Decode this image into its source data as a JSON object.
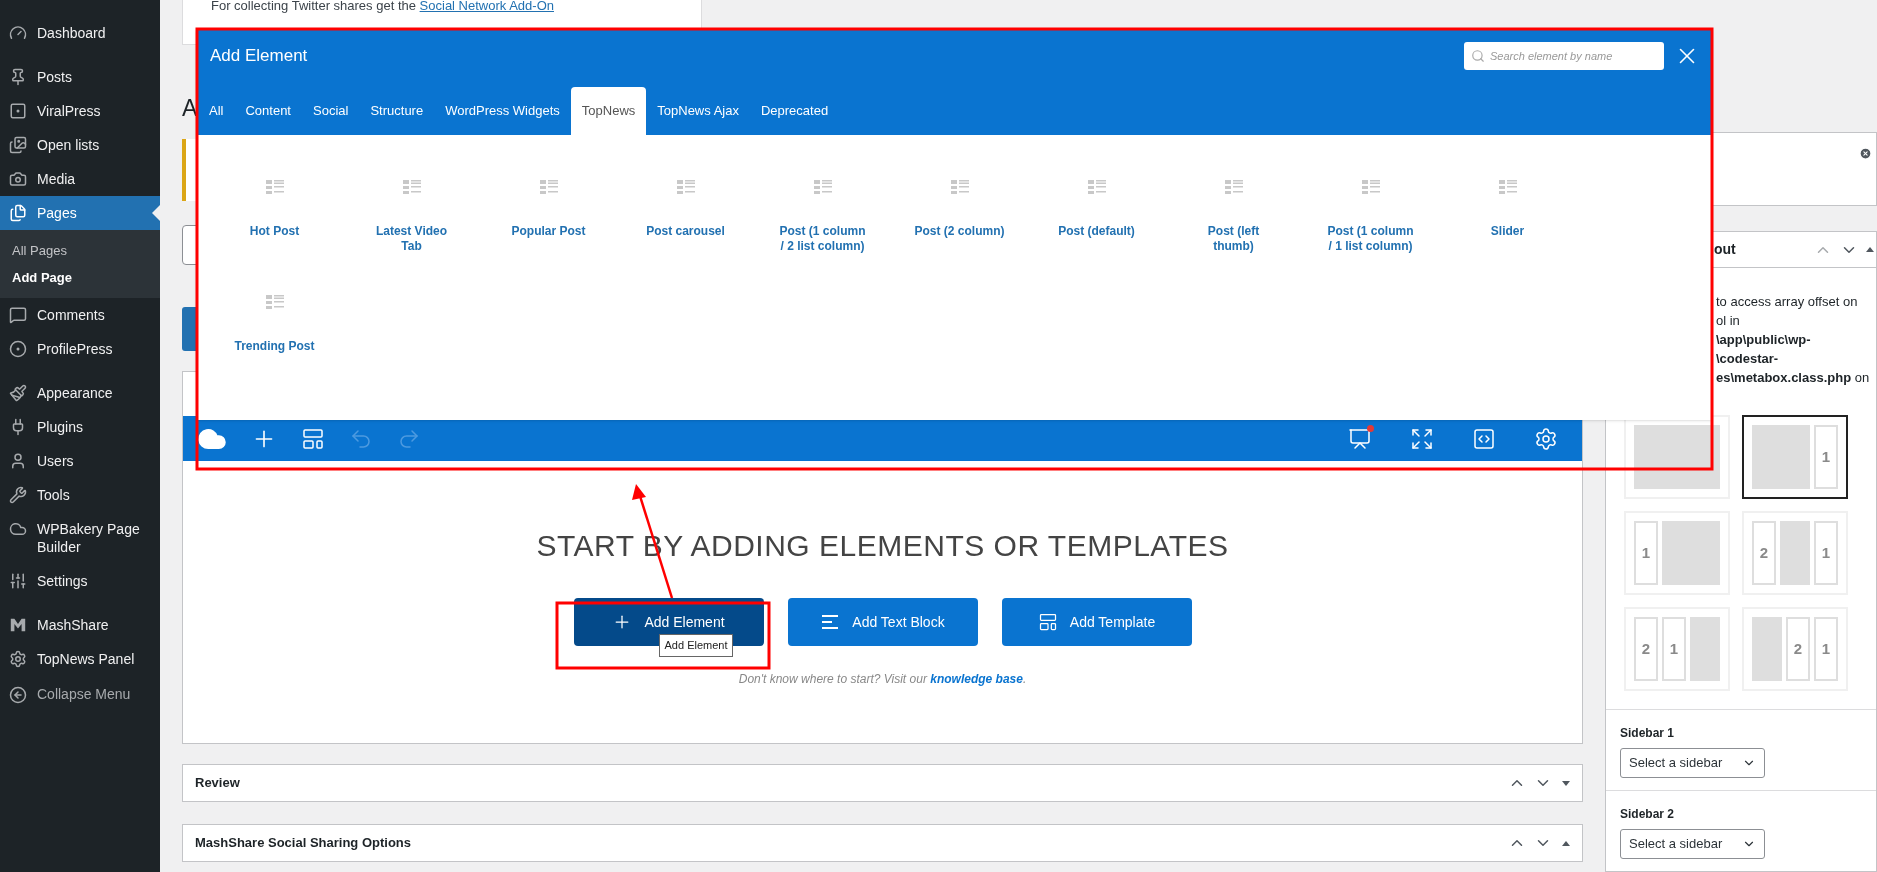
{
  "admin_menu": {
    "groups": [
      [
        {
          "label": "Dashboard",
          "selected": false
        }
      ],
      [
        {
          "label": "Posts",
          "selected": false
        },
        {
          "label": "ViralPress",
          "selected": false
        },
        {
          "label": "Open lists",
          "selected": false
        },
        {
          "label": "Media",
          "selected": false
        },
        {
          "label": "Pages",
          "selected": true,
          "children": [
            {
              "label": "All Pages",
              "selected": false
            },
            {
              "label": "Add Page",
              "selected": true
            }
          ]
        },
        {
          "label": "Comments",
          "selected": false
        },
        {
          "label": "ProfilePress",
          "selected": false
        }
      ],
      [
        {
          "label": "Appearance",
          "selected": false
        },
        {
          "label": "Plugins",
          "selected": false
        },
        {
          "label": "Users",
          "selected": false
        },
        {
          "label": "Tools",
          "selected": false
        },
        {
          "label": "WPBakery Page Builder",
          "selected": false
        },
        {
          "label": "Settings",
          "selected": false
        }
      ],
      [
        {
          "label": "MashShare",
          "selected": false
        },
        {
          "label": "TopNews Panel",
          "selected": false
        }
      ]
    ],
    "collapse": "Collapse Menu"
  },
  "top_notice": {
    "text": "For collecting Twitter shares get the",
    "link": "Social Network Add-On"
  },
  "heading_fragment": "A",
  "modal": {
    "title": "Add Element",
    "search_placeholder": "Search element by name",
    "tabs": [
      {
        "label": "All",
        "selected": false
      },
      {
        "label": "Content",
        "selected": false
      },
      {
        "label": "Social",
        "selected": false
      },
      {
        "label": "Structure",
        "selected": false
      },
      {
        "label": "WordPress Widgets",
        "selected": false
      },
      {
        "label": "TopNews",
        "selected": true
      },
      {
        "label": "TopNews Ajax",
        "selected": false
      },
      {
        "label": "Deprecated",
        "selected": false
      }
    ],
    "elements": [
      "Hot Post",
      "Latest Video Tab",
      "Popular Post",
      "Post carousel",
      "Post (1 column / 2 list column)",
      "Post (2 column)",
      "Post (default)",
      "Post (left thumb)",
      "Post (1 column / 1 list column)",
      "Slider",
      "Trending Post"
    ]
  },
  "builder": {
    "navbar": {
      "undo": {
        "disabled": true
      },
      "redo": {
        "disabled": true
      },
      "preview": {
        "has_notification": true
      }
    },
    "heading": "START BY ADDING ELEMENTS OR TEMPLATES",
    "buttons": [
      {
        "label": "Add Element",
        "hovered": true
      },
      {
        "label": "Add Text Block",
        "hovered": false
      },
      {
        "label": "Add Template",
        "hovered": false
      }
    ],
    "tooltip": "Add Element",
    "help": {
      "text": "Don't know where to start? Visit our",
      "link": "knowledge base",
      "end": "."
    }
  },
  "metaboxes": [
    {
      "title": "Review",
      "expanded": false
    },
    {
      "title": "MashShare Social Sharing Options",
      "expanded": true
    }
  ],
  "layout_box": {
    "title_fragment": "out",
    "expanded": true,
    "notice_lines": [
      {
        "text": "to access array offset on",
        "bold": false
      },
      {
        "text": "ol in",
        "bold": false
      },
      {
        "text": "\\app\\public\\wp-",
        "bold": true
      },
      {
        "text": "\\codestar-",
        "bold": true
      },
      {
        "text": "**es\\metabox.class.php** on",
        "bold": false
      }
    ],
    "tiles": [
      {
        "kind": "full",
        "selected": false
      },
      {
        "kind": "content-right",
        "labels": [
          "1"
        ],
        "selected": true
      },
      {
        "kind": "left-content",
        "labels": [
          "1"
        ],
        "selected": false
      },
      {
        "kind": "left-content-right",
        "labels": [
          "2",
          "1"
        ],
        "selected": false
      },
      {
        "kind": "left-left-content",
        "labels": [
          "2",
          "1"
        ],
        "selected": false
      },
      {
        "kind": "content-right-right",
        "labels": [
          "2",
          "1"
        ],
        "selected": false
      }
    ],
    "fields": [
      {
        "label": "Sidebar 1",
        "value": "Select a sidebar"
      },
      {
        "label": "Sidebar 2",
        "value": "Select a sidebar"
      }
    ]
  }
}
